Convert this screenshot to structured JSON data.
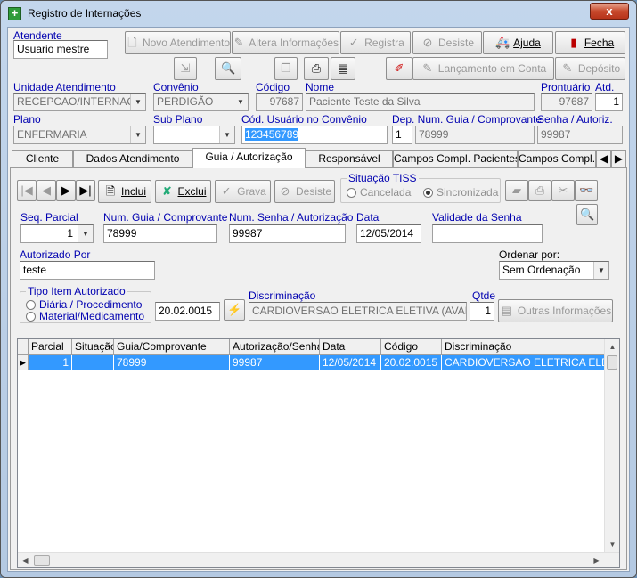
{
  "window": {
    "title": "Registro de Internações",
    "close_label": "x"
  },
  "atendente": {
    "label": "Atendente",
    "value": "Usuario mestre"
  },
  "toolbar": {
    "novo_atendimento": "Novo Atendimento",
    "altera_informacoes": "Altera Informações",
    "registra": "Registra",
    "desiste": "Desiste",
    "ajuda": "Ajuda",
    "fecha": "Fecha",
    "lancamento_em_conta": "Lançamento em Conta",
    "deposito": "Depósito"
  },
  "header": {
    "unidade_label": "Unidade Atendimento",
    "unidade_value": "RECEPCAO/INTERNACA",
    "convenio_label": "Convênio",
    "convenio_value": "PERDIGÃO",
    "codigo_label": "Código",
    "codigo_value": "97687",
    "nome_label": "Nome",
    "nome_value": "Paciente Teste da Silva",
    "prontuario_label": "Prontuário",
    "prontuario_value": "97687",
    "atd_label": "Atd.",
    "atd_value": "1",
    "plano_label": "Plano",
    "plano_value": "ENFERMARIA",
    "subplano_label": "Sub Plano",
    "subplano_value": "",
    "cod_usuario_label": "Cód. Usuário no Convênio",
    "cod_usuario_value": "123456789",
    "dep_label": "Dep. Num. Guia / Comprovante",
    "dep_value": "1",
    "guia_value": "78999",
    "senha_label": "Senha / Autoriz.",
    "senha_value": "99987"
  },
  "tabs": [
    {
      "label": "Cliente"
    },
    {
      "label": "Dados Atendimento"
    },
    {
      "label": "Guia / Autorização"
    },
    {
      "label": "Responsável"
    },
    {
      "label": "Campos Compl. Pacientes"
    },
    {
      "label": "Campos Compl. A"
    }
  ],
  "guia": {
    "inclui": "Inclui",
    "exclui": "Exclui",
    "grava": "Grava",
    "desiste": "Desiste",
    "situacao_tiss": "Situação TISS",
    "cancelada": "Cancelada",
    "sincronizada": "Sincronizada",
    "seq_parcial_label": "Seq. Parcial",
    "seq_parcial_value": "1",
    "num_guia_label": "Num. Guia / Comprovante",
    "num_guia_value": "78999",
    "num_senha_label": "Num. Senha / Autorização",
    "num_senha_value": "99987",
    "data_label": "Data",
    "data_value": "12/05/2014",
    "validade_label": "Validade da Senha",
    "validade_value": "",
    "autorizado_label": "Autorizado Por",
    "autorizado_value": "teste",
    "ordenar_label": "Ordenar por:",
    "ordenar_value": "Sem Ordenação",
    "tipo_item_label": "Tipo Item Autorizado",
    "diaria": "Diária / Procedimento",
    "material": "Material/Medicamento",
    "item_code": "20.02.0015",
    "discriminacao_label": "Discriminação",
    "discriminacao_value": "CARDIOVERSAO ELETRICA ELETIVA (AVALIA",
    "qtde_label": "Qtde",
    "qtde_value": "1",
    "outras_informacoes": "Outras Informações"
  },
  "grid": {
    "columns": [
      "Parcial",
      "Situação",
      "Guia/Comprovante",
      "Autorização/Senha",
      "Data",
      "Código",
      "Discriminação"
    ],
    "rows": [
      [
        "1",
        "",
        "78999",
        "99987",
        "12/05/2014",
        "20.02.0015",
        "CARDIOVERSAO ELETRICA ELETIVA"
      ]
    ]
  }
}
